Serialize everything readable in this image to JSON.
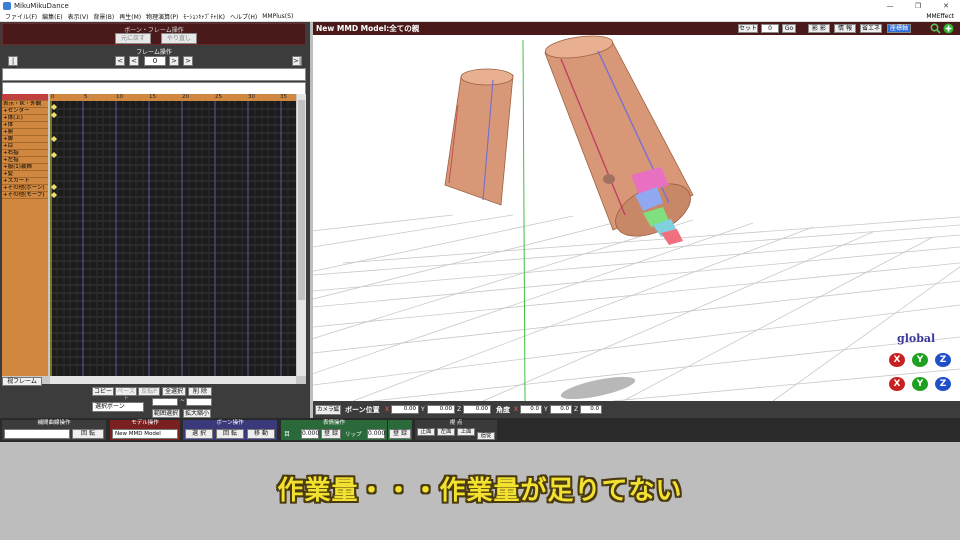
{
  "window": {
    "title": "MikuMikuDance",
    "controls": [
      "—",
      "❐",
      "✕"
    ]
  },
  "menu": {
    "items": [
      "ファイル(F)",
      "編集(E)",
      "表示(V)",
      "背景(B)",
      "再生(M)",
      "物理演算(P)",
      "ﾓｰｼｮﾝｷｬﾌﾟﾁｬ(K)",
      "ヘルプ(H)",
      "MMPlus(S)"
    ],
    "right": "MMEffect"
  },
  "bone_frame_panel": {
    "title": "ボーン・フレーム操作",
    "undo_label": "元に戻す",
    "redo_label": "やり直し",
    "frame_op_label": "フレーム操作",
    "nav": {
      "first": "|<",
      "prev_key": "<",
      "prev": "<",
      "next": ">",
      "next_key": ">",
      "last": ">|"
    },
    "current_frame": "0"
  },
  "timeline": {
    "ruler": [
      "0",
      "5",
      "10",
      "15",
      "20",
      "25",
      "30",
      "35"
    ],
    "rows": [
      "",
      "表示・IK・外観",
      "+センター",
      "+体(上)",
      "+体",
      "+腕",
      "+脚",
      "+目",
      "+右指",
      "+左指",
      "+服(1)装飾",
      "+髪",
      "+スカート",
      "+その他(ボーン)",
      "+その他(モーフ)"
    ],
    "tab_label": "视フレーム"
  },
  "frame_tools": {
    "copy": "コピー",
    "paste": "ペースト",
    "reverse_paste": "反転P",
    "select_all": "全選択",
    "delete": "削 除",
    "bone_select": "選択ボーン",
    "range_select": "範囲選択",
    "scale": "拡大縮小",
    "tilde": "~"
  },
  "viewport": {
    "title": "New MMD Model:全ての親",
    "set_label": "セット",
    "set_value": "0",
    "go_label": "Go",
    "buttons": [
      "影 影",
      "情 報",
      "省エネ",
      "座標軸"
    ],
    "global_label": "global",
    "axes_top": [
      "X",
      "Y",
      "Z"
    ],
    "axes_bottom": [
      "X",
      "Y",
      "Z"
    ]
  },
  "coords": {
    "camera_label": "カメラ編",
    "bone_pos_label": "ボーン位置",
    "angle_label": "角度",
    "pos": {
      "x": "0.00",
      "y": "0.00",
      "z": "0.00"
    },
    "rot": {
      "x": "0.0",
      "y": "0.0",
      "z": "0.0"
    },
    "axis_x": "X",
    "axis_y": "Y",
    "axis_z": "Z"
  },
  "bottom": {
    "interp_title": "補間曲線操作",
    "interp_select": "",
    "rotate_label": "回 転",
    "model_title": "モデル操作",
    "model_select": "New MMD Model",
    "bone_title": "ボーン操作",
    "select_label": "選 択",
    "rotate2_label": "回 転",
    "move_label": "移 動",
    "face_title": "表情操作",
    "eye_label": "目",
    "eye_value": "0.000",
    "register1": "登 録",
    "lip_label": "リップ",
    "lip_value": "0.000",
    "register2": "登 録",
    "view_title": "視 点",
    "view_front": "正面",
    "view_left": "左面",
    "view_top": "上面",
    "view_follow": "追従"
  },
  "subtitle": "作業量・・・作業量が足りてない"
}
